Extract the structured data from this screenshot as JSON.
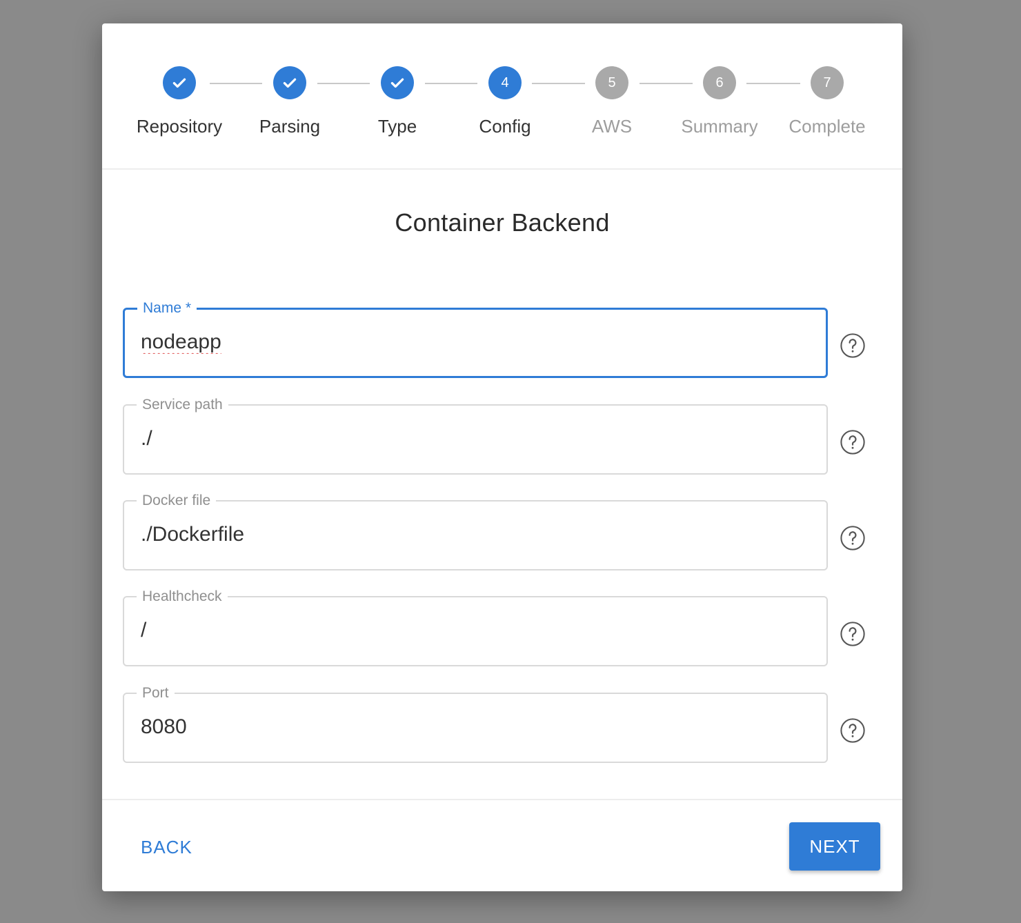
{
  "stepper": {
    "steps": [
      {
        "label": "Repository",
        "number": "1",
        "status": "done"
      },
      {
        "label": "Parsing",
        "number": "2",
        "status": "done"
      },
      {
        "label": "Type",
        "number": "3",
        "status": "done"
      },
      {
        "label": "Config",
        "number": "4",
        "status": "active"
      },
      {
        "label": "AWS",
        "number": "5",
        "status": "pending"
      },
      {
        "label": "Summary",
        "number": "6",
        "status": "pending"
      },
      {
        "label": "Complete",
        "number": "7",
        "status": "pending"
      }
    ]
  },
  "form": {
    "title": "Container Backend",
    "fields": [
      {
        "label": "Name *",
        "value": "nodeapp",
        "help_icon": "help-circle-icon"
      },
      {
        "label": "Service path",
        "value": "./",
        "help_icon": "help-circle-icon"
      },
      {
        "label": "Docker file",
        "value": "./Dockerfile",
        "help_icon": "help-circle-icon"
      },
      {
        "label": "Healthcheck",
        "value": "/",
        "help_icon": "help-circle-icon"
      },
      {
        "label": "Port",
        "value": "8080",
        "help_icon": "help-circle-icon"
      }
    ]
  },
  "footer": {
    "back_label": "BACK",
    "next_label": "NEXT"
  },
  "colors": {
    "accent": "#2f7cd6",
    "pending": "#a9a9a9",
    "backdrop": "#8a8a8a"
  }
}
